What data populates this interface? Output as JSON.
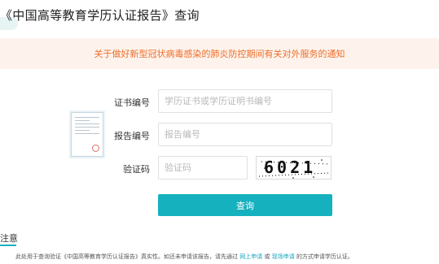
{
  "header": {
    "title": "《中国高等教育学历认证报告》查询"
  },
  "notice": {
    "text": "关于做好新型冠状病毒感染的肺炎防控期间有关对外服务的通知"
  },
  "form": {
    "cert_label": "证书编号",
    "cert_placeholder": "学历证书或学历证明书编号",
    "report_label": "报告编号",
    "report_placeholder": "报告编号",
    "captcha_label": "验证码",
    "captcha_placeholder": "验证码",
    "captcha_image_text": "6021",
    "submit_label": "查询"
  },
  "notes": {
    "heading": "注意",
    "text_before": "此处用于查询验证《中国高等教育学历认证报告》真实性。如还未申请该报告，请先通过",
    "link_online": "网上申请",
    "text_or": "或",
    "link_onsite": "现场申请",
    "text_after": "的方式申请学历认证。"
  },
  "colors": {
    "accent": "#16b1bf",
    "notice_text": "#ee6e2b",
    "notice_bg": "#fdf3ec"
  }
}
